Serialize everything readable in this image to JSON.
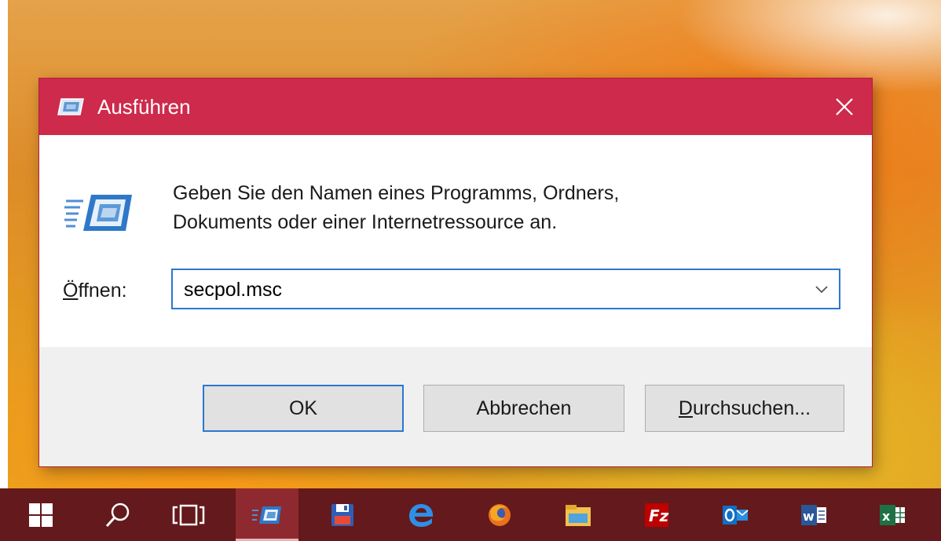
{
  "dialog": {
    "title": "Ausführen",
    "description_line1": "Geben Sie den Namen eines Programms, Ordners,",
    "description_line2": "Dokuments oder einer Internetressource an.",
    "open_label_accel": "Ö",
    "open_label_rest": "ffnen:",
    "open_value": "secpol.msc",
    "buttons": {
      "ok": "OK",
      "cancel": "Abbrechen",
      "browse_accel": "D",
      "browse_rest": "urchsuchen..."
    }
  },
  "colors": {
    "titlebar": "#ce2a4b",
    "focus_border": "#2a78d2",
    "taskbar": "#64191c",
    "taskbar_active": "#8e2a2f"
  },
  "taskbar": {
    "items": [
      {
        "icon": "windows-start-icon",
        "active": false
      },
      {
        "icon": "search-icon",
        "active": false
      },
      {
        "icon": "task-view-icon",
        "active": false
      },
      {
        "icon": "run-dialog-icon",
        "active": true
      },
      {
        "icon": "floppy-save-icon",
        "active": false
      },
      {
        "icon": "edge-browser-icon",
        "active": false
      },
      {
        "icon": "firefox-icon",
        "active": false
      },
      {
        "icon": "file-explorer-icon",
        "active": false
      },
      {
        "icon": "filezilla-icon",
        "active": false
      },
      {
        "icon": "outlook-icon",
        "active": false
      },
      {
        "icon": "word-icon",
        "active": false
      },
      {
        "icon": "excel-icon",
        "active": false
      }
    ]
  }
}
